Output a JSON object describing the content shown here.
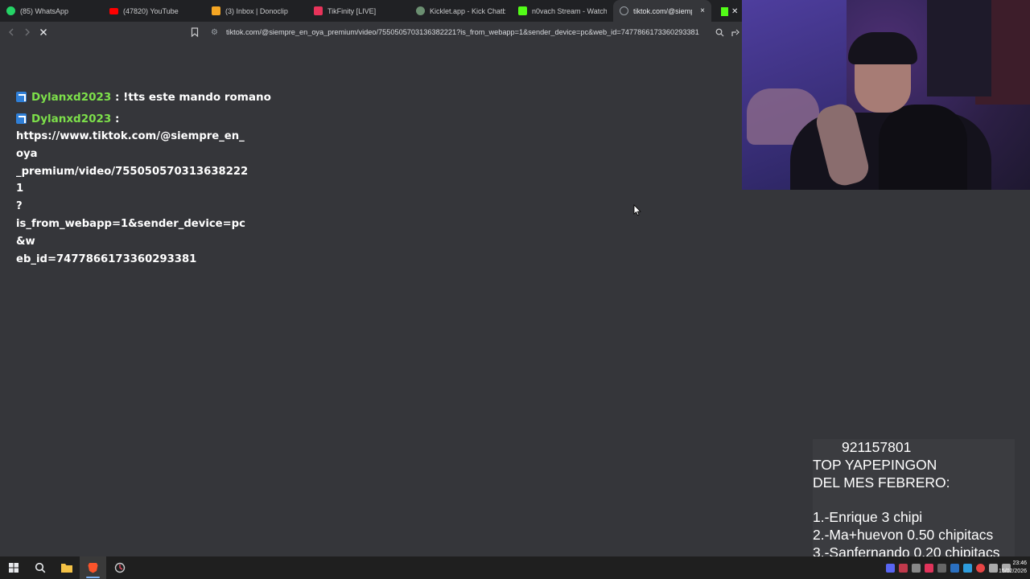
{
  "browser": {
    "tabs": [
      {
        "label": "(85) WhatsApp",
        "icon": "whatsapp-icon",
        "color": "#25d366",
        "active": false
      },
      {
        "label": "(47820) YouTube",
        "icon": "youtube-icon",
        "color": "#ff0000",
        "active": false
      },
      {
        "label": "(3) Inbox | Donoclip",
        "icon": "donoclip-icon",
        "color": "#f5a623",
        "active": false
      },
      {
        "label": "TikFinity [LIVE]",
        "icon": "tikfinity-icon",
        "color": "#e8335a",
        "active": false
      },
      {
        "label": "Kicklet.app - Kick Chatbot",
        "icon": "kicklet-icon",
        "color": "#6b8f71",
        "active": false
      },
      {
        "label": "n0vach Stream - Watch Li",
        "icon": "kick-icon",
        "color": "#53fc18",
        "active": false
      },
      {
        "label": "tiktok.com/@siempre",
        "icon": "globe-icon",
        "color": "#9aa0a6",
        "active": true
      }
    ],
    "active_tab_close": "×",
    "address": "tiktok.com/@siempre_en_oya_premium/video/7550505703136382221?is_from_webapp=1&sender_device=pc&web_id=7477866173360293381"
  },
  "chat": {
    "messages": [
      {
        "user": "Dylanxd2023",
        "separator": " : ",
        "text": "!tts este mando romano"
      },
      {
        "user": "Dylanxd2023",
        "separator": " :",
        "text": "https://www.tiktok.com/@siempre_en_oya_premium/video/7550505703136382221?is_from_webapp=1&sender_device=pc&web_id=7477866173360293381"
      }
    ],
    "link_lines": [
      "https://www.tiktok.com/@siempre_en_oya",
      "_premium/video/7550505703136382221",
      "?",
      "is_from_webapp=1&sender_device=pc&w",
      "eb_id=7477866173360293381"
    ]
  },
  "overlay": {
    "phone": "921157801",
    "heading_1": "TOP YAPEPINGON",
    "heading_2": "DEL MES FEBRERO:",
    "ranking": [
      "1.-Enrique 3 chipi",
      "2.-Ma+huevon 0.50 chipitacs",
      "3.-Sanfernando 0.20 chipitacs"
    ]
  },
  "taskbar": {
    "time": "23:46",
    "date": "15/02/2026"
  },
  "colors": {
    "username": "#7de04a",
    "badge": "#2f7fd7",
    "page_bg": "#35363a",
    "tabstrip_bg": "#202124"
  }
}
